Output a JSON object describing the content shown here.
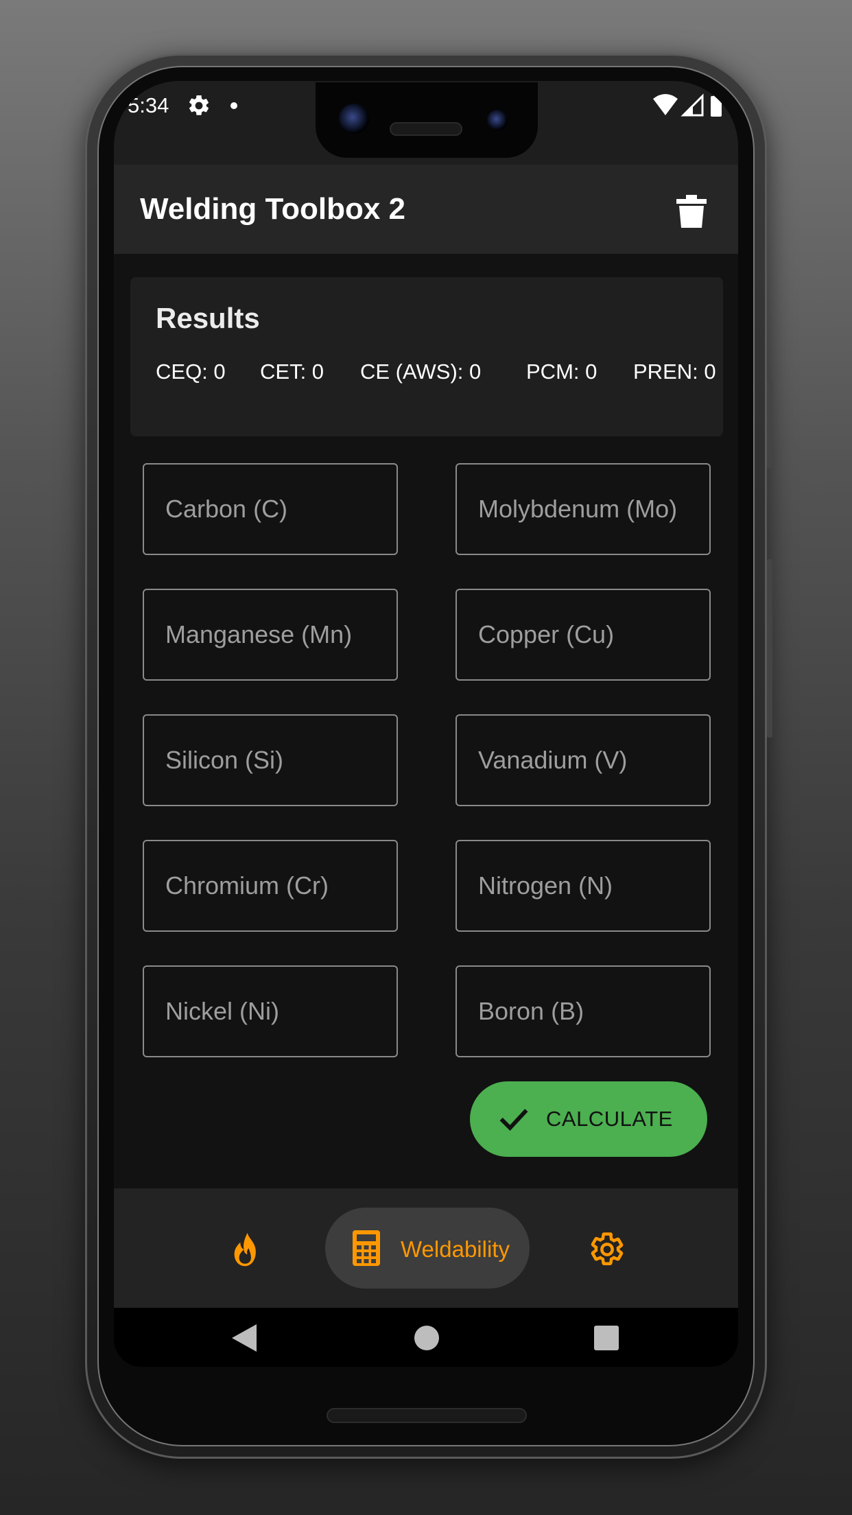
{
  "status_bar": {
    "time": "5:34",
    "icons": [
      "settings-icon",
      "notification-dot-icon",
      "wifi-icon",
      "cell-signal-icon",
      "battery-icon"
    ]
  },
  "app_bar": {
    "title": "Welding Toolbox 2",
    "action_icon": "trash-icon"
  },
  "results": {
    "title": "Results",
    "items": [
      {
        "label": "CEQ: 0"
      },
      {
        "label": "CET: 0"
      },
      {
        "label": "CE (AWS): 0"
      },
      {
        "label": "PCM: 0"
      },
      {
        "label": "PREN: 0"
      }
    ]
  },
  "fields": [
    {
      "placeholder": "Carbon (C)",
      "value": ""
    },
    {
      "placeholder": "Molybdenum (Mo)",
      "value": ""
    },
    {
      "placeholder": "Manganese (Mn)",
      "value": ""
    },
    {
      "placeholder": "Copper (Cu)",
      "value": ""
    },
    {
      "placeholder": "Silicon (Si)",
      "value": ""
    },
    {
      "placeholder": "Vanadium (V)",
      "value": ""
    },
    {
      "placeholder": "Chromium (Cr)",
      "value": ""
    },
    {
      "placeholder": "Nitrogen (N)",
      "value": ""
    },
    {
      "placeholder": "Nickel (Ni)",
      "value": ""
    },
    {
      "placeholder": "Boron (B)",
      "value": ""
    }
  ],
  "calculate_button": {
    "label": "CALCULATE",
    "icon": "check-icon",
    "color": "#4caf50"
  },
  "bottom_nav": {
    "accent_color": "#ff9800",
    "items": [
      {
        "icon": "flame-icon",
        "label": ""
      },
      {
        "icon": "calculator-icon",
        "label": "Weldability",
        "active": true
      },
      {
        "icon": "gear-icon",
        "label": ""
      }
    ]
  },
  "system_nav": {
    "icons": [
      "back-icon",
      "home-icon",
      "recents-icon"
    ]
  }
}
